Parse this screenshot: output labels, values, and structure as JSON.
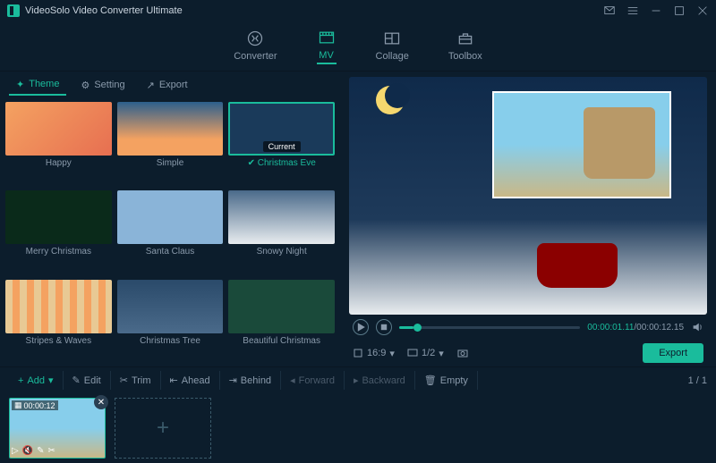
{
  "app": {
    "title": "VideoSolo Video Converter Ultimate"
  },
  "maintabs": {
    "converter": "Converter",
    "mv": "MV",
    "collage": "Collage",
    "toolbox": "Toolbox"
  },
  "subtabs": {
    "theme": "Theme",
    "setting": "Setting",
    "export": "Export"
  },
  "themes": [
    {
      "label": "Happy"
    },
    {
      "label": "Simple"
    },
    {
      "label": "Christmas Eve",
      "selected": true,
      "badge": "Current"
    },
    {
      "label": "Merry Christmas"
    },
    {
      "label": "Santa Claus"
    },
    {
      "label": "Snowy Night"
    },
    {
      "label": "Stripes & Waves"
    },
    {
      "label": "Christmas Tree"
    },
    {
      "label": "Beautiful Christmas"
    }
  ],
  "player": {
    "current_time": "00:00:01.11",
    "total_time": "00:00:12.15"
  },
  "options": {
    "ratio": "16:9",
    "fraction": "1/2",
    "export": "Export"
  },
  "toolbar": {
    "add": "Add",
    "edit": "Edit",
    "trim": "Trim",
    "ahead": "Ahead",
    "behind": "Behind",
    "forward": "Forward",
    "backward": "Backward",
    "empty": "Empty"
  },
  "pager": "1 / 1",
  "clip": {
    "duration": "00:00:12"
  }
}
